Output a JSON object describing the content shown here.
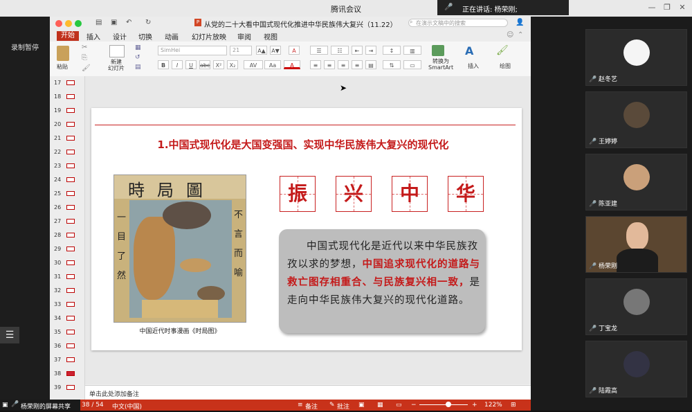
{
  "window": {
    "title": "腾讯会议",
    "speaking": "正在讲话: 杨荣刚;"
  },
  "left": {
    "record_label": "录制暂停",
    "list_icon": "☰"
  },
  "doc": {
    "title": "从党的二十大看中国式现代化推进中华民族伟大复兴（11.22）",
    "search_placeholder": "在演示文稿中的搜索"
  },
  "tabs": [
    "开始",
    "插入",
    "设计",
    "切换",
    "动画",
    "幻灯片放映",
    "审阅",
    "视图"
  ],
  "ribbon": {
    "paste": "粘贴",
    "new_slide": "新建\n幻灯片",
    "font": "SimHei",
    "size": "21",
    "convert": "转换为\nSmartArt",
    "insert": "插入",
    "draw": "绘图"
  },
  "thumbs": [
    "17",
    "18",
    "19",
    "20",
    "21",
    "22",
    "23",
    "24",
    "25",
    "26",
    "27",
    "28",
    "29",
    "30",
    "31",
    "32",
    "33",
    "34",
    "35",
    "36",
    "37",
    "38",
    "39"
  ],
  "selected_thumb": "38",
  "slide": {
    "title": "1.中国式现代化是大国变强国、实现中华民族伟大复兴的现代化",
    "cartoon_title": "時局圖",
    "cartoon_left": "一目了然",
    "cartoon_right": "不言而喻",
    "caption": "中国近代时事漫画《时局图》",
    "chars": [
      "振",
      "兴",
      "中",
      "华"
    ],
    "text_a": "中国式现代化是近代以来中华民族孜孜以求的梦想，",
    "text_b": "中国追求现代化的道路与救亡图存相重合、与民族复兴相一致，",
    "text_c": "是走向中华民族伟大复兴的现代化道路。"
  },
  "notes": "单击此处添加备注",
  "status": {
    "share": "杨荣刚的屏幕共享",
    "page": "38 / 54",
    "lang": "中文(中国)",
    "notes": "备注",
    "comments": "批注",
    "zoom": "122%",
    "zoom_level": 0.6
  },
  "participants": [
    {
      "name": "赵冬艺",
      "avatar": "cat-avatar"
    },
    {
      "name": "王婷婷",
      "avatar": "person-avatar"
    },
    {
      "name": "陈亚建",
      "avatar": "person-avatar"
    },
    {
      "name": "杨荣刚",
      "avatar": "video"
    },
    {
      "name": "丁宝龙",
      "avatar": "elephant-avatar"
    },
    {
      "name": "陆霞高",
      "avatar": "books-avatar"
    }
  ]
}
